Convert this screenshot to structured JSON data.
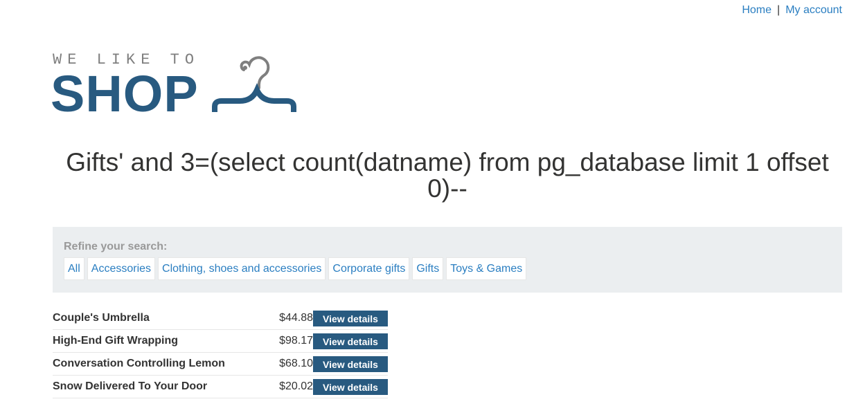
{
  "nav": {
    "home": "Home",
    "separator": "|",
    "account": "My account"
  },
  "logo": {
    "tagline": "WE LIKE TO",
    "wordmark": "SHOP",
    "icon": "hanger-icon",
    "tagline_color": "#7f7f7f",
    "wordmark_color": "#285a80"
  },
  "page_title": "Gifts' and 3=(select count(datname) from pg_database limit 1 offset 0)--",
  "filters": {
    "label": "Refine your search:",
    "items": [
      "All",
      "Accessories",
      "Clothing, shoes and accessories",
      "Corporate gifts",
      "Gifts",
      "Toys & Games"
    ]
  },
  "products": [
    {
      "name": "Couple's Umbrella",
      "price": "$44.88",
      "button": "View details"
    },
    {
      "name": "High-End Gift Wrapping",
      "price": "$98.17",
      "button": "View details"
    },
    {
      "name": "Conversation Controlling Lemon",
      "price": "$68.10",
      "button": "View details"
    },
    {
      "name": "Snow Delivered To Your Door",
      "price": "$20.02",
      "button": "View details"
    }
  ],
  "colors": {
    "link": "#2a7ec1",
    "brand": "#285a80",
    "filter_bg": "#ebeef0"
  }
}
